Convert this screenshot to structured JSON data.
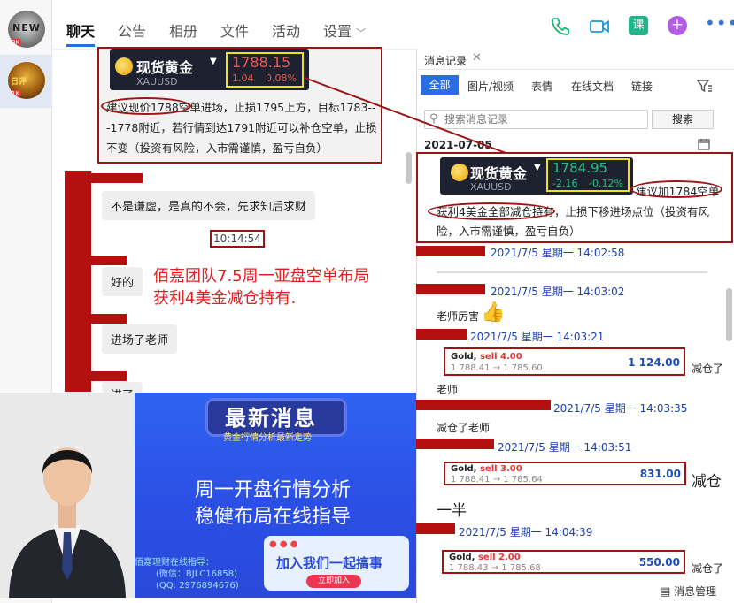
{
  "avatars": [
    {
      "label": "NEW",
      "badge": "8K"
    },
    {
      "label": "日评",
      "badge": "1K"
    }
  ],
  "nav": {
    "tabs": [
      "聊天",
      "公告",
      "相册",
      "文件",
      "活动",
      "设置"
    ]
  },
  "chat": {
    "quote": {
      "name": "现货黄金",
      "symbol": "XAUUSD",
      "price": "1788.15",
      "change": "1.04",
      "pct": "0.08%"
    },
    "message1": "建议现价1788空单进场，止损1795上方，目标1783---1778附近，若行情到达1791附近可以补仓空单，止损不变（投资有风险，入市需谨慎，盈亏自负）",
    "message2": "不是谦虚，是真的不会，先求知后求财",
    "time": "10:14:54",
    "message3": "好的",
    "annotation_line1": "佰嘉团队7.5周一亚盘空单布局",
    "annotation_line2": "获利4美金减仓持有.",
    "message4": "进场了老师",
    "message5": "进了"
  },
  "promo": {
    "headline": "最新消息",
    "subhead": "黄金行情分析最新走势",
    "line1": "周一开盘行情分析",
    "line2": "稳健布局在线指导",
    "contact_title": "佰嘉理财在线指导：",
    "wechat": "(微信：BJLC16858)",
    "qq": "(QQ:  2976894676)",
    "cta": "加入我们一起搞事",
    "cta_button": "立即加入"
  },
  "records": {
    "title": "消息记录",
    "tabs": [
      "全部",
      "图片/视频",
      "表情",
      "在线文档",
      "链接"
    ],
    "search_placeholder": "搜索消息记录",
    "search_button": "搜索",
    "date": "2021-07-05",
    "quote": {
      "name": "现货黄金",
      "symbol": "XAUUSD",
      "price": "1784.95",
      "change": "-2.16",
      "pct": "-0.12%"
    },
    "msg_head": "建议加1784空单",
    "msg_body": "获利4美金全部减仓持有，止损下移进场点位（投资有风险，入市需谨慎，盈亏自负）",
    "stamps": [
      "2021/7/5 星期一 14:02:58",
      "2021/7/5 星期一 14:03:02",
      "2021/7/5 星期一 14:03:21",
      "2021/7/5 星期一 14:03:35",
      "2021/7/5 星期一 14:03:51",
      "2021/7/5 星期一 14:04:39"
    ],
    "praise": "老师厉害",
    "trades": [
      {
        "title": "Gold,",
        "side": "sell 4.00",
        "route": "1 788.41 → 1 785.60",
        "profit": "1 124.00",
        "note": "减仓了"
      },
      {
        "title": "Gold,",
        "side": "sell 3.00",
        "route": "1 788.41 → 1 785.64",
        "profit": "831.00",
        "note": "减仓"
      },
      {
        "title": "Gold,",
        "side": "sell 2.00",
        "route": "1 788.43 → 1 785.68",
        "profit": "550.00",
        "note": "减仓了"
      }
    ],
    "teacher1": "老师",
    "teacher2": "减仓了老师",
    "half": "一半",
    "manage": "消息管理"
  }
}
